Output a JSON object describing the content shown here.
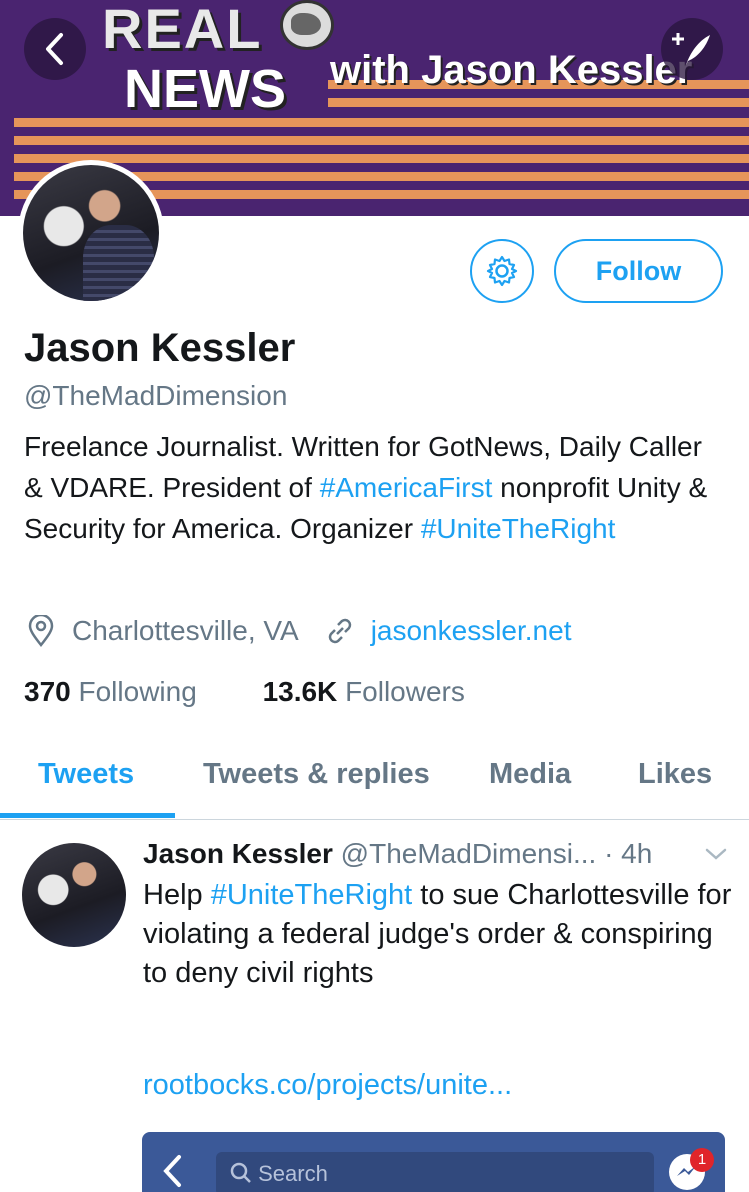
{
  "banner": {
    "line1": "REAL",
    "line2": "NEWS",
    "line3": "with Jason Kessler"
  },
  "profile": {
    "name": "Jason Kessler",
    "handle": "@TheMadDimension",
    "follow_label": "Follow",
    "bio": {
      "part1": "Freelance Journalist. Written for GotNews, Daily Caller & VDARE. President of ",
      "hashtag1": "#AmericaFirst",
      "part2": " nonprofit Unity & Security for America. Organizer ",
      "hashtag2": "#UniteTheRight"
    },
    "location": "Charlottesville, VA",
    "website": "jasonkessler.net",
    "following_count": "370",
    "following_label": "Following",
    "followers_count": "13.6K",
    "followers_label": "Followers"
  },
  "tabs": [
    {
      "label": "Tweets"
    },
    {
      "label": "Tweets & replies"
    },
    {
      "label": "Media"
    },
    {
      "label": "Likes"
    }
  ],
  "tweet": {
    "name": "Jason Kessler",
    "handle": "@TheMadDimensi...",
    "time": "· 4h",
    "text_prefix": "Help ",
    "hashtag": "#UniteTheRight",
    "text_rest": " to sue Charlottesville for violating a federal judge's order & conspiring to deny civil rights",
    "link": "rootbocks.co/projects/unite..."
  },
  "embed": {
    "search_placeholder": "Search",
    "badge": "1"
  },
  "colors": {
    "accent": "#1da1f2",
    "banner_bg": "#4a2470",
    "stripe": "#e6955a"
  }
}
